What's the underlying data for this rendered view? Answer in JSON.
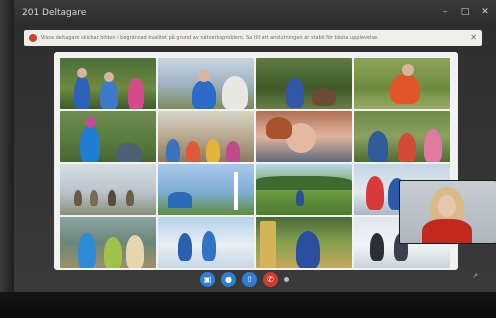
{
  "window": {
    "title": "201 Deltagare",
    "minimize": "–",
    "maximize": "□",
    "close": "✕"
  },
  "banner": {
    "text": "Vissa deltagare skickar bilden i begränsad kvalitet på grund av nätverksproblem. Se till att anslutningen är stabil för bästa upplevelse.",
    "close": "✕"
  },
  "call_controls": {
    "video": "▣",
    "mic": "●",
    "share": "⇧",
    "hangup": "✆"
  },
  "tray": "↗",
  "colors": {
    "hangup": "#d23a2e",
    "control": "#2f7fd6",
    "banner_bg": "#efefe9"
  }
}
